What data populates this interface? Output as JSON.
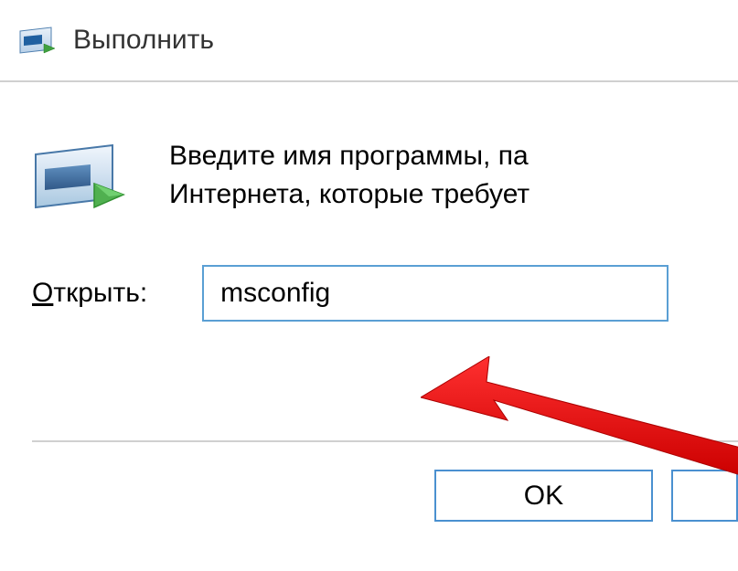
{
  "titlebar": {
    "title": "Выполнить"
  },
  "body": {
    "description": "Введите имя программы, папки, документа или ресурса Интернета, которые требуется открыть.",
    "description_line1": "Введите имя программы, па",
    "description_line2": "Интернета, которые требует"
  },
  "input": {
    "label_underlined": "О",
    "label_rest": "ткрыть:",
    "value": "msconfig"
  },
  "buttons": {
    "ok": "OK"
  }
}
